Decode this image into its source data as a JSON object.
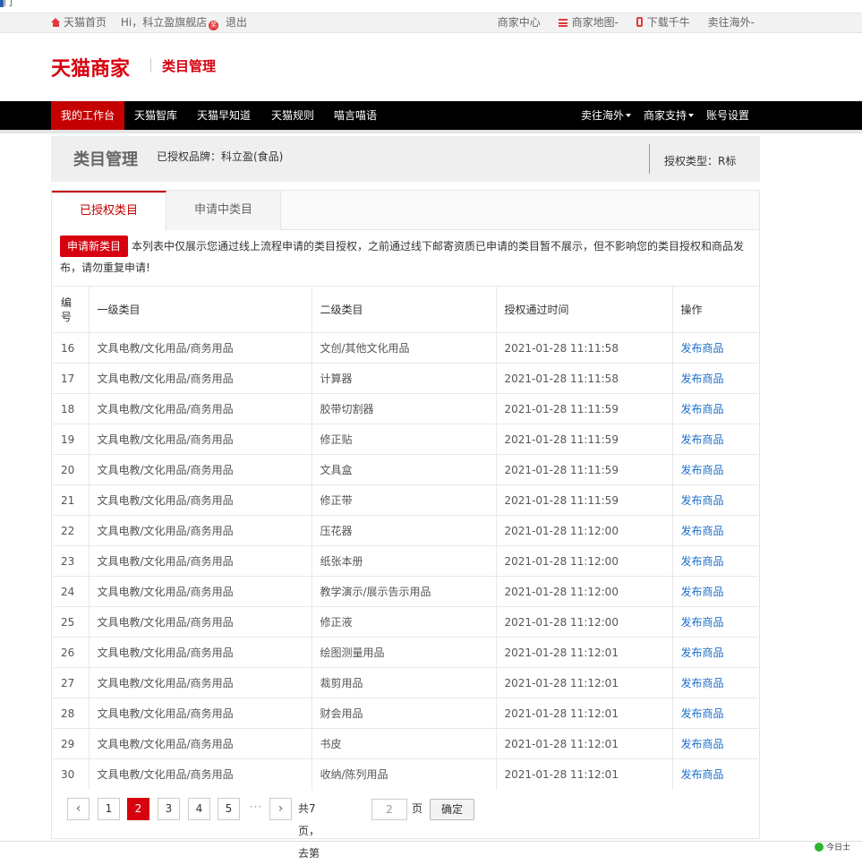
{
  "browser_fragment": "门",
  "topbar": {
    "home": "天猫首页",
    "greeting": "Hi，科立盈旗舰店",
    "badge": "奖",
    "logout": "退出",
    "merchant_center": "商家中心",
    "merchant_map": "商家地图",
    "download": "下载千牛",
    "sell_overseas": "卖往海外"
  },
  "header": {
    "logo": "天猫商家",
    "subtitle": "类目管理"
  },
  "nav": {
    "left": [
      "我的工作台",
      "天猫智库",
      "天猫早知道",
      "天猫规则",
      "喵言喵语"
    ],
    "right": [
      "卖往海外",
      "商家支持",
      "账号设置"
    ]
  },
  "page": {
    "title": "类目管理",
    "brand": "已授权品牌：科立盈(食品)",
    "auth_type": "授权类型：R标"
  },
  "tabs": [
    "已授权类目",
    "申请中类目"
  ],
  "notice": {
    "button": "申请新类目",
    "text": "本列表中仅展示您通过线上流程申请的类目授权，之前通过线下邮寄资质已申请的类目暂不展示，但不影响您的类目授权和商品发布，请勿重复申请!"
  },
  "table": {
    "headers": [
      "编号",
      "一级类目",
      "二级类目",
      "授权通过时间",
      "操作"
    ],
    "rows": [
      [
        "16",
        "文具电教/文化用品/商务用品",
        "文创/其他文化用品",
        "2021-01-28 11:11:58",
        "发布商品"
      ],
      [
        "17",
        "文具电教/文化用品/商务用品",
        "计算器",
        "2021-01-28 11:11:58",
        "发布商品"
      ],
      [
        "18",
        "文具电教/文化用品/商务用品",
        "胶带切割器",
        "2021-01-28 11:11:59",
        "发布商品"
      ],
      [
        "19",
        "文具电教/文化用品/商务用品",
        "修正贴",
        "2021-01-28 11:11:59",
        "发布商品"
      ],
      [
        "20",
        "文具电教/文化用品/商务用品",
        "文具盒",
        "2021-01-28 11:11:59",
        "发布商品"
      ],
      [
        "21",
        "文具电教/文化用品/商务用品",
        "修正带",
        "2021-01-28 11:11:59",
        "发布商品"
      ],
      [
        "22",
        "文具电教/文化用品/商务用品",
        "压花器",
        "2021-01-28 11:12:00",
        "发布商品"
      ],
      [
        "23",
        "文具电教/文化用品/商务用品",
        "纸张本册",
        "2021-01-28 11:12:00",
        "发布商品"
      ],
      [
        "24",
        "文具电教/文化用品/商务用品",
        "教学演示/展示告示用品",
        "2021-01-28 11:12:00",
        "发布商品"
      ],
      [
        "25",
        "文具电教/文化用品/商务用品",
        "修正液",
        "2021-01-28 11:12:00",
        "发布商品"
      ],
      [
        "26",
        "文具电教/文化用品/商务用品",
        "绘图测量用品",
        "2021-01-28 11:12:01",
        "发布商品"
      ],
      [
        "27",
        "文具电教/文化用品/商务用品",
        "裁剪用品",
        "2021-01-28 11:12:01",
        "发布商品"
      ],
      [
        "28",
        "文具电教/文化用品/商务用品",
        "财会用品",
        "2021-01-28 11:12:01",
        "发布商品"
      ],
      [
        "29",
        "文具电教/文化用品/商务用品",
        "书皮",
        "2021-01-28 11:12:01",
        "发布商品"
      ],
      [
        "30",
        "文具电教/文化用品/商务用品",
        "收纳/陈列用品",
        "2021-01-28 11:12:01",
        "发布商品"
      ]
    ]
  },
  "pager": {
    "prev": "‹",
    "pages": [
      "1",
      "2",
      "3",
      "4",
      "5"
    ],
    "current": "2",
    "dots": "···",
    "next": "›",
    "total_text": "共7页，去第",
    "goto_value": "2",
    "suffix": "页",
    "ok": "确定"
  },
  "bottom_fragment": "今日士"
}
